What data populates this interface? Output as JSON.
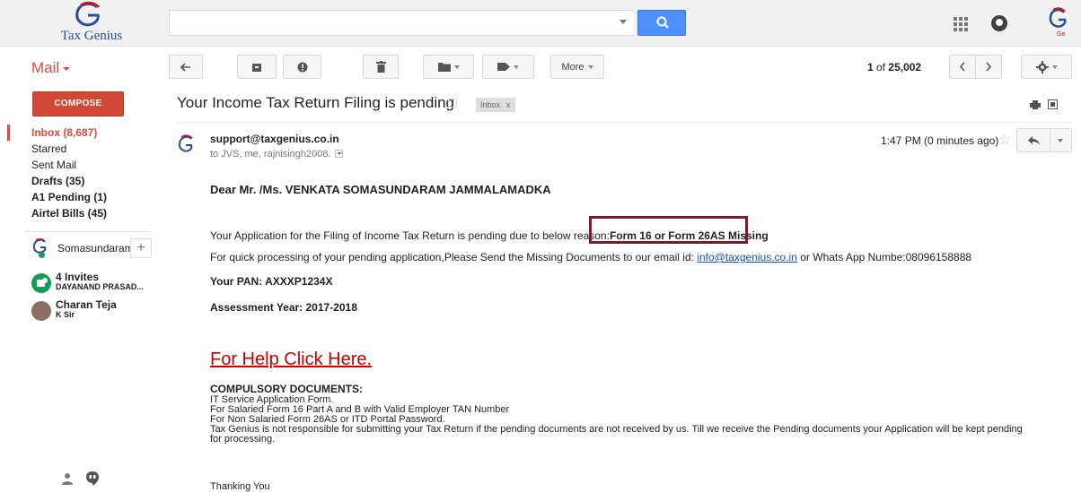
{
  "app": {
    "logo_text": "Tax Genius",
    "mail_label": "Mail"
  },
  "search": {
    "value": "",
    "placeholder": ""
  },
  "toolbar": {
    "more_label": "More",
    "page_count_range": "1",
    "page_count_of": "of",
    "page_count_total": "25,002"
  },
  "sidebar": {
    "compose_label": "COMPOSE",
    "items": [
      {
        "label": "Inbox (8,687)"
      },
      {
        "label": "Starred"
      },
      {
        "label": "Sent Mail"
      },
      {
        "label": "Drafts (35)"
      },
      {
        "label": "A1 Pending (1)"
      },
      {
        "label": "Airtel Bills (45)"
      }
    ],
    "hangouts_user": "Somasundaram",
    "contacts": [
      {
        "name": "4 Invites",
        "sub": "DAYANAND PRASAD..."
      },
      {
        "name": "Charan Teja",
        "sub": "K Sir"
      }
    ]
  },
  "message": {
    "subject": "Your Income Tax Return Filing is pending",
    "label_chip": "Inbox",
    "label_chip_close": "x",
    "from": "support@taxgenius.co.in",
    "to": "to JVS, me, rajnisingh2008.",
    "time": "1:47 PM (0 minutes ago)",
    "greeting": "Dear Mr. /Ms. VENKATA SOMASUNDARAM JAMMALAMADKA",
    "reason_prefix": "Your Application for the Filing of Income Tax Return is pending due to below reason:",
    "reason_highlight": "Form 16 or Form 26AS Missing",
    "quick_prefix": "For quick processing of your pending application,Please Send the Missing Documents to our email id:",
    "quick_email": "info@taxgenius.co.in",
    "quick_suffix": "or Whats App Numbe:08096158888",
    "pan": "Your PAN: AXXXP1234X",
    "assessment_year": "Assessment Year: 2017-2018",
    "help_link": "For Help Click Here.",
    "docs_heading": "COMPULSORY DOCUMENTS:",
    "docs_lines": [
      "IT Service Application Form.",
      "For Salaried Form 16 Part A and B with Valid Employer TAN Number",
      "For Non Salaried Form 26AS or ITD Portal Password.",
      "Tax Genius is not responsible for submitting your Tax Return if the pending documents are not received by us. Till we receive the Pending documents your Application will be kept pending",
      "for processing."
    ],
    "closing": "Thanking You"
  },
  "colors": {
    "accent": "#dd4b39",
    "compose": "#d14836",
    "search_button": "#4d90fe",
    "highlight_border": "#7b1a2c",
    "link": "#1155cc",
    "help_link": "#cc0000"
  }
}
